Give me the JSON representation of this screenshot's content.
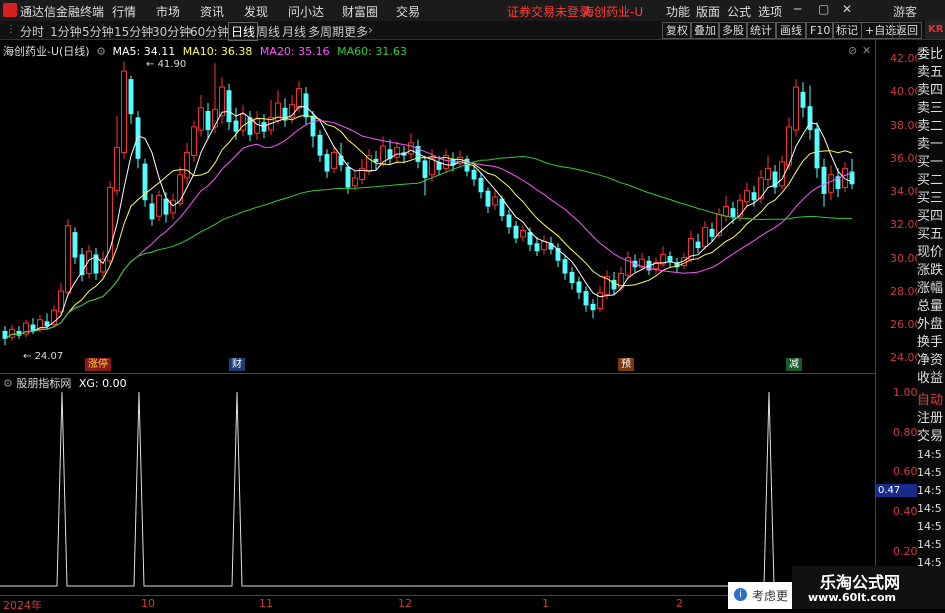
{
  "app": {
    "name": "通达信金融终端",
    "menus": [
      "行情",
      "市场",
      "资讯",
      "发现",
      "问小达",
      "财富圈",
      "交易"
    ],
    "status_text": "证券交易未登录",
    "stock_title": "海创药业-U",
    "right_menus": [
      "功能",
      "版面",
      "公式",
      "选项"
    ],
    "user": "游客"
  },
  "toolbar": {
    "periods": [
      "分时",
      "1分钟",
      "5分钟",
      "15分钟",
      "30分钟",
      "60分钟",
      "日线",
      "周线",
      "月线",
      "多周期",
      "更多"
    ],
    "active_period": "日线",
    "right_buttons": [
      "复权",
      "叠加",
      "多股",
      "统计",
      "画线",
      "F10",
      "标记",
      "+自选",
      "返回"
    ],
    "kr_label": "KR"
  },
  "main_panel": {
    "title": "海创药业-U(日线)",
    "ma": [
      {
        "label": "MA5: 34.11",
        "color": "#ffffff"
      },
      {
        "label": "MA10: 36.38",
        "color": "#ffff55"
      },
      {
        "label": "MA20: 35.16",
        "color": "#ff55ff"
      },
      {
        "label": "MA60: 31.63",
        "color": "#33cc33"
      }
    ],
    "high_label": "41.90",
    "low_label": "24.07",
    "tags": [
      {
        "text": "涨停",
        "color": "#d23b3b"
      },
      {
        "text": "财",
        "color": "#2d5fb0"
      },
      {
        "text": "预",
        "color": "#c06020"
      },
      {
        "text": "减",
        "color": "#2a8a3a"
      }
    ]
  },
  "indicator": {
    "title": "股朋指标网",
    "xg": "XG: 0.00",
    "value_box": "0.47",
    "yticks": [
      "1.00",
      "0.80",
      "0.60",
      "0.40",
      "0.20"
    ]
  },
  "price_axis": [
    "42.00",
    "40.00",
    "38.00",
    "36.00",
    "34.00",
    "32.00",
    "30.00",
    "28.00",
    "26.00",
    "24.00"
  ],
  "x_axis": [
    "2024年",
    "10",
    "11",
    "12",
    "1",
    "2"
  ],
  "right_panel": {
    "items": [
      "委比",
      "卖五",
      "卖四",
      "卖三",
      "卖二",
      "卖一",
      "买一",
      "买二",
      "买三",
      "买四",
      "买五",
      "现价",
      "涨跌",
      "涨幅",
      "总量",
      "外盘",
      "换手",
      "净资",
      "收益"
    ],
    "lower": [
      "自动",
      "注册",
      "交易"
    ],
    "times": [
      "14:5",
      "14:5",
      "14:5",
      "14:5",
      "14:5",
      "14:5",
      "14:5"
    ]
  },
  "popup": {
    "text": "考虑更"
  },
  "watermark": {
    "line1": "乐淘公式网",
    "line2": "www.60lt.com"
  },
  "chart_data": {
    "type": "candlestick",
    "ylim": [
      23.3,
      42.5
    ],
    "candles": [
      [
        25.0,
        24.5,
        25.3,
        24.1
      ],
      [
        24.6,
        25.1,
        25.4,
        24.4
      ],
      [
        25.0,
        24.7,
        25.3,
        24.5
      ],
      [
        24.8,
        25.5,
        25.7,
        24.6
      ],
      [
        25.4,
        25.0,
        25.8,
        24.8
      ],
      [
        25.1,
        25.7,
        26.0,
        24.9
      ],
      [
        25.6,
        25.3,
        26.1,
        25.1
      ],
      [
        25.4,
        26.3,
        26.6,
        25.2
      ],
      [
        26.2,
        27.5,
        28.0,
        26.0
      ],
      [
        27.4,
        31.6,
        32.0,
        27.2
      ],
      [
        31.2,
        29.6,
        31.5,
        29.2
      ],
      [
        29.8,
        28.5,
        30.2,
        28.1
      ],
      [
        28.6,
        30.0,
        30.4,
        28.3
      ],
      [
        29.8,
        28.6,
        30.2,
        28.2
      ],
      [
        28.7,
        29.5,
        30.0,
        28.4
      ],
      [
        29.4,
        34.0,
        34.4,
        29.2
      ],
      [
        33.8,
        36.5,
        38.5,
        33.5
      ],
      [
        36.2,
        41.3,
        41.9,
        35.8
      ],
      [
        40.8,
        38.6,
        41.0,
        38.0
      ],
      [
        38.4,
        35.8,
        38.8,
        35.2
      ],
      [
        35.5,
        33.2,
        35.8,
        32.8
      ],
      [
        33.0,
        32.0,
        33.6,
        31.6
      ],
      [
        32.2,
        33.5,
        33.8,
        31.9
      ],
      [
        33.3,
        32.3,
        33.7,
        31.8
      ],
      [
        32.4,
        33.2,
        33.6,
        32.0
      ],
      [
        33.0,
        34.8,
        35.3,
        32.8
      ],
      [
        34.6,
        36.2,
        36.8,
        34.2
      ],
      [
        36.0,
        37.8,
        38.2,
        35.6
      ],
      [
        37.6,
        39.0,
        39.8,
        37.2
      ],
      [
        38.8,
        37.6,
        39.3,
        37.0
      ],
      [
        37.8,
        38.9,
        41.8,
        37.4
      ],
      [
        38.5,
        40.3,
        40.9,
        38.0
      ],
      [
        40.1,
        38.1,
        40.5,
        37.6
      ],
      [
        38.2,
        37.5,
        39.0,
        37.0
      ],
      [
        37.6,
        38.6,
        39.2,
        37.2
      ],
      [
        38.4,
        37.3,
        38.8,
        36.9
      ],
      [
        37.4,
        38.3,
        38.8,
        37.0
      ],
      [
        38.1,
        37.5,
        38.6,
        37.1
      ],
      [
        37.6,
        38.4,
        39.5,
        37.3
      ],
      [
        38.2,
        39.3,
        40.1,
        38.0
      ],
      [
        39.0,
        38.2,
        39.6,
        37.8
      ],
      [
        38.4,
        39.2,
        39.8,
        38.0
      ],
      [
        39.0,
        40.2,
        40.7,
        38.7
      ],
      [
        39.9,
        38.4,
        40.3,
        37.9
      ],
      [
        38.5,
        37.2,
        38.8,
        36.5
      ],
      [
        37.3,
        36.0,
        37.6,
        35.6
      ],
      [
        36.1,
        35.0,
        36.4,
        34.6
      ],
      [
        35.2,
        36.2,
        36.6,
        34.9
      ],
      [
        36.0,
        35.4,
        36.8,
        35.0
      ],
      [
        35.3,
        34.0,
        35.6,
        33.6
      ],
      [
        34.1,
        34.6,
        35.0,
        33.8
      ],
      [
        34.5,
        35.2,
        35.8,
        34.2
      ],
      [
        35.0,
        36.0,
        36.4,
        34.8
      ],
      [
        35.8,
        35.6,
        36.3,
        35.1
      ],
      [
        35.5,
        36.6,
        37.2,
        35.3
      ],
      [
        36.4,
        35.8,
        37.0,
        35.4
      ],
      [
        35.9,
        36.5,
        36.9,
        35.5
      ],
      [
        36.2,
        36.0,
        36.6,
        35.6
      ],
      [
        36.1,
        36.8,
        37.4,
        35.8
      ],
      [
        36.6,
        35.6,
        37.0,
        35.2
      ],
      [
        35.7,
        34.6,
        36.0,
        33.5
      ],
      [
        34.8,
        35.8,
        36.4,
        34.4
      ],
      [
        35.6,
        35.1,
        36.0,
        34.8
      ],
      [
        35.2,
        36.0,
        36.4,
        34.9
      ],
      [
        35.8,
        35.4,
        36.2,
        35.0
      ],
      [
        35.5,
        35.9,
        36.3,
        35.2
      ],
      [
        35.8,
        35.0,
        36.0,
        34.7
      ],
      [
        35.1,
        34.5,
        35.4,
        34.1
      ],
      [
        34.6,
        33.7,
        34.9,
        33.3
      ],
      [
        33.8,
        32.8,
        34.0,
        32.4
      ],
      [
        32.9,
        33.4,
        33.8,
        32.6
      ],
      [
        33.3,
        32.2,
        33.5,
        31.9
      ],
      [
        32.3,
        31.5,
        32.6,
        31.1
      ],
      [
        31.6,
        30.8,
        31.9,
        30.5
      ],
      [
        30.9,
        31.3,
        31.6,
        30.6
      ],
      [
        31.2,
        30.4,
        31.5,
        30.0
      ],
      [
        30.5,
        30.0,
        30.9,
        29.7
      ],
      [
        30.1,
        30.6,
        31.0,
        29.8
      ],
      [
        30.5,
        30.1,
        30.9,
        29.8
      ],
      [
        30.2,
        29.4,
        30.5,
        29.0
      ],
      [
        29.5,
        28.6,
        29.8,
        28.2
      ],
      [
        28.7,
        28.0,
        29.0,
        27.6
      ],
      [
        28.1,
        27.4,
        28.4,
        27.0
      ],
      [
        27.5,
        26.6,
        27.8,
        26.2
      ],
      [
        26.7,
        26.3,
        27.0,
        25.8
      ],
      [
        26.4,
        27.4,
        27.8,
        26.2
      ],
      [
        27.3,
        28.4,
        28.8,
        27.0
      ],
      [
        28.2,
        27.6,
        28.7,
        27.3
      ],
      [
        27.7,
        28.6,
        29.0,
        27.5
      ],
      [
        28.5,
        29.6,
        30.0,
        28.3
      ],
      [
        29.4,
        29.0,
        29.8,
        28.7
      ],
      [
        29.0,
        29.5,
        29.9,
        28.8
      ],
      [
        29.4,
        28.8,
        29.7,
        28.5
      ],
      [
        28.9,
        29.3,
        29.6,
        28.6
      ],
      [
        29.2,
        29.8,
        30.3,
        29.0
      ],
      [
        29.7,
        29.3,
        30.0,
        29.0
      ],
      [
        29.3,
        29.0,
        29.6,
        28.7
      ],
      [
        29.1,
        29.6,
        29.9,
        28.9
      ],
      [
        29.5,
        30.8,
        31.3,
        29.3
      ],
      [
        30.6,
        30.2,
        31.1,
        29.9
      ],
      [
        30.3,
        31.5,
        31.9,
        30.1
      ],
      [
        31.4,
        30.9,
        31.8,
        30.6
      ],
      [
        31.0,
        32.3,
        32.7,
        30.8
      ],
      [
        32.2,
        32.8,
        33.5,
        31.9
      ],
      [
        32.7,
        32.1,
        33.1,
        31.7
      ],
      [
        32.2,
        33.2,
        33.6,
        31.9
      ],
      [
        33.1,
        33.8,
        34.3,
        32.8
      ],
      [
        33.7,
        33.2,
        34.1,
        32.8
      ],
      [
        33.3,
        34.6,
        35.1,
        33.0
      ],
      [
        34.5,
        35.2,
        36.0,
        34.1
      ],
      [
        35.0,
        34.0,
        35.4,
        33.6
      ],
      [
        34.1,
        35.6,
        36.0,
        33.9
      ],
      [
        35.4,
        37.8,
        38.4,
        35.1
      ],
      [
        37.6,
        40.3,
        40.8,
        37.2
      ],
      [
        40.0,
        39.0,
        40.6,
        38.4
      ],
      [
        39.1,
        37.6,
        40.4,
        37.0
      ],
      [
        37.7,
        35.2,
        38.1,
        34.6
      ],
      [
        35.3,
        33.6,
        35.8,
        32.8
      ],
      [
        33.7,
        34.8,
        35.4,
        33.2
      ],
      [
        34.7,
        33.9,
        35.2,
        33.4
      ],
      [
        34.0,
        35.2,
        35.6,
        33.7
      ],
      [
        35.0,
        34.2,
        35.8,
        33.9
      ]
    ]
  }
}
